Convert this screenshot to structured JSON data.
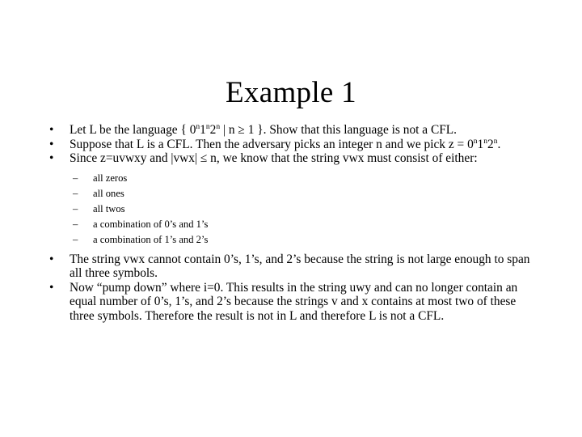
{
  "slide": {
    "title": "Example 1",
    "background_color": "#ffffff",
    "text_color": "#000000",
    "bullet_marker": "•",
    "sub_bullet_marker": "–",
    "bullets": [
      {
        "level": 1,
        "text_parts": [
          "Let L be the language { 0",
          "n",
          "1",
          "n",
          "2",
          "n",
          " | n ≥ 1 }.  Show that this language is not a CFL."
        ]
      },
      {
        "level": 1,
        "text_parts": [
          "Suppose that L is a CFL. Then the adversary picks an integer n and we pick z = 0",
          "n",
          "1",
          "n",
          "2",
          "n",
          "."
        ]
      },
      {
        "level": 1,
        "text": "Since z=uvwxy and |vwx| ≤ n, we know that the string vwx must consist of either:"
      },
      {
        "level": 2,
        "text": "all zeros"
      },
      {
        "level": 2,
        "text": "all ones"
      },
      {
        "level": 2,
        "text": "all twos"
      },
      {
        "level": 2,
        "text": "a combination of 0’s and 1’s"
      },
      {
        "level": 2,
        "text": "a combination of 1’s and 2’s"
      },
      {
        "level": 1,
        "text": "The string vwx cannot contain 0’s, 1’s, and 2’s because the string is not large enough to span all three symbols."
      },
      {
        "level": 1,
        "text": "Now “pump down” where i=0.  This results in the string uwy and can no longer contain an equal number of 0’s, 1’s, and 2’s because the strings v and x contains at most two of these three symbols.   Therefore the result is not in L and therefore L is not a CFL."
      }
    ]
  }
}
